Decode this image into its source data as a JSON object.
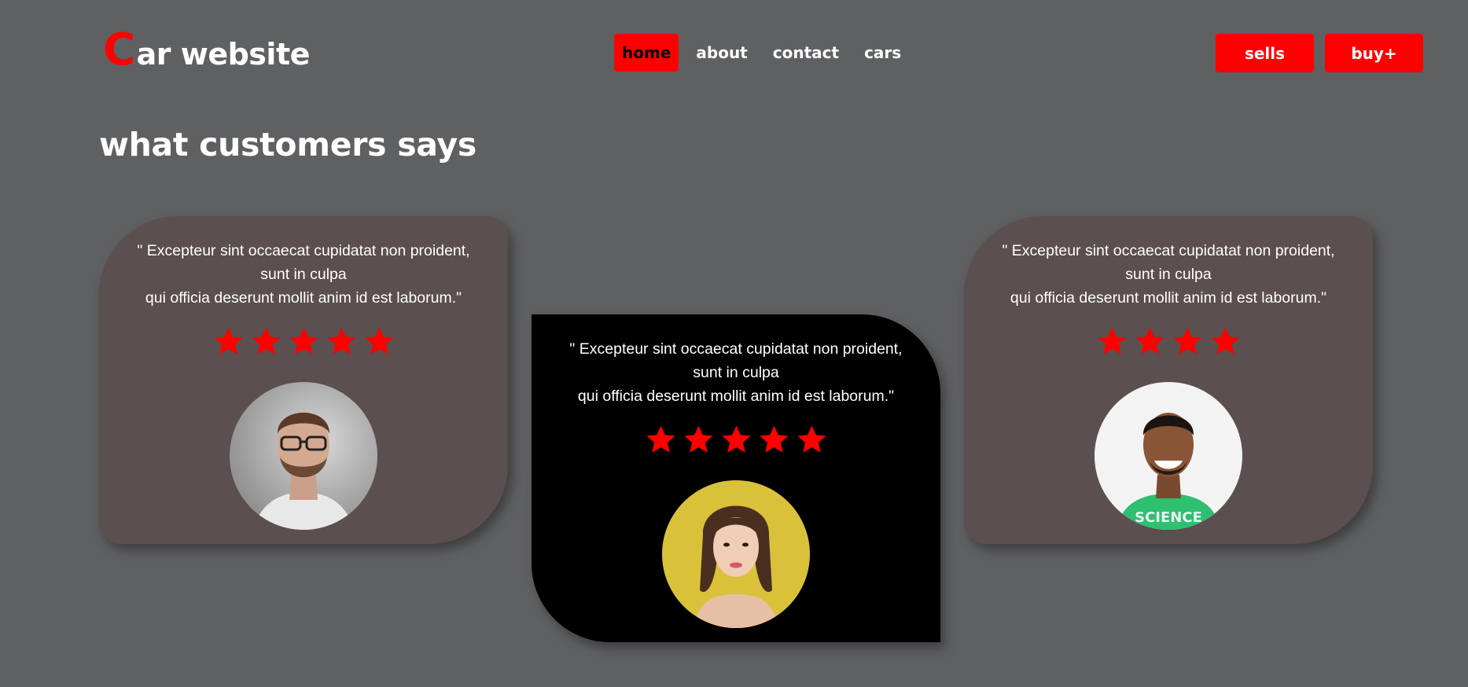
{
  "header": {
    "logo_first": "C",
    "logo_rest": "ar website",
    "nav": [
      {
        "label": "home",
        "active": true
      },
      {
        "label": "about",
        "active": false
      },
      {
        "label": "contact",
        "active": false
      },
      {
        "label": "cars",
        "active": false
      }
    ],
    "actions": [
      {
        "label": "sells"
      },
      {
        "label": "buy+"
      }
    ]
  },
  "section": {
    "title": "what customers says"
  },
  "testimonials": [
    {
      "line1": "\" Excepteur sint occaecat cupidatat non proident,",
      "line2": "sunt in culpa",
      "line3": "qui officia deserunt mollit anim id est laborum.\"",
      "rating": 5,
      "avatar_icon": "man-with-glasses-portrait"
    },
    {
      "line1": "\" Excepteur sint occaecat cupidatat non proident,",
      "line2": "sunt in culpa",
      "line3": "qui officia deserunt mollit anim id est laborum.\"",
      "rating": 5,
      "avatar_icon": "woman-yellow-background-portrait"
    },
    {
      "line1": "\" Excepteur sint occaecat cupidatat non proident,",
      "line2": "sunt in culpa",
      "line3": "qui officia deserunt mollit anim id est laborum.\"",
      "rating": 4,
      "avatar_icon": "smiling-man-green-shirt-portrait",
      "shirt_text": "SCIENCE"
    }
  ],
  "colors": {
    "page_bg": "#5f6062",
    "accent": "#ff0000",
    "card_brown": "#5b4f4f",
    "card_black": "#000000"
  }
}
